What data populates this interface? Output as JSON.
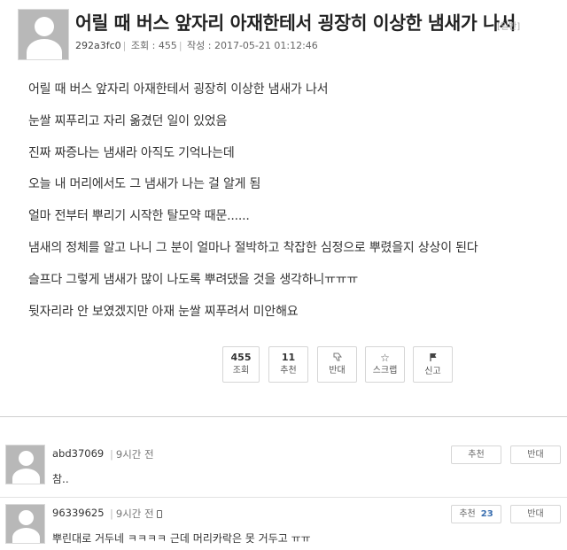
{
  "post": {
    "title": "어릴 때 버스 앞자리 아재한테서 굉장히 이상한 냄새가 나서",
    "category": "[일반]",
    "author": "292a3fc0",
    "views_label": "조회 : 455",
    "date_label": "작성 : 2017-05-21 01:12:46",
    "body": [
      "어릴 때 버스 앞자리 아재한테서 굉장히 이상한 냄새가 나서",
      "눈쌀 찌푸리고 자리 옮겼던 일이 있었음",
      "진짜 짜증나는 냄새라 아직도 기억나는데",
      "오늘 내 머리에서도 그 냄새가 나는 걸 알게 됨",
      "얼마 전부터 뿌리기 시작한 탈모약 때문......",
      "냄새의 정체를 알고 나니 그 분이 얼마나 절박하고 착잡한 심정으로 뿌렸을지 상상이 된다",
      "슬프다 그렇게 냄새가 많이 나도록 뿌려댔을 것을 생각하니ㅠㅠㅠ",
      "뒷자리라 안 보였겠지만 아재 눈쌀 찌푸려서 미안해요"
    ],
    "actions": {
      "views_count": "455",
      "views_label": "조회",
      "recommend_count": "11",
      "recommend_label": "추천",
      "oppose_icon": "thumbs-down-icon",
      "oppose_label": "반대",
      "scrap_icon": "star-icon",
      "scrap_label": "스크랩",
      "report_icon": "flag-icon",
      "report_label": "신고"
    }
  },
  "comments": [
    {
      "author": "abd37069",
      "time": "9시간 전",
      "text": "참..",
      "recommend_label": "추천",
      "recommend_count": "",
      "oppose_label": "반대"
    },
    {
      "author": "96339625",
      "time": "9시간 전",
      "mobile_icon": "mobile-phone-icon",
      "text": "뿌린대로 거두네 ㅋㅋㅋㅋ 근데 머리카락은 못 거두고 ㅠㅠ",
      "recommend_label": "추천",
      "recommend_count": "23",
      "oppose_label": "반대"
    }
  ],
  "colors": {
    "recommend_count": "#3a6fb0",
    "avatar_bg": "#b8b8b8"
  }
}
